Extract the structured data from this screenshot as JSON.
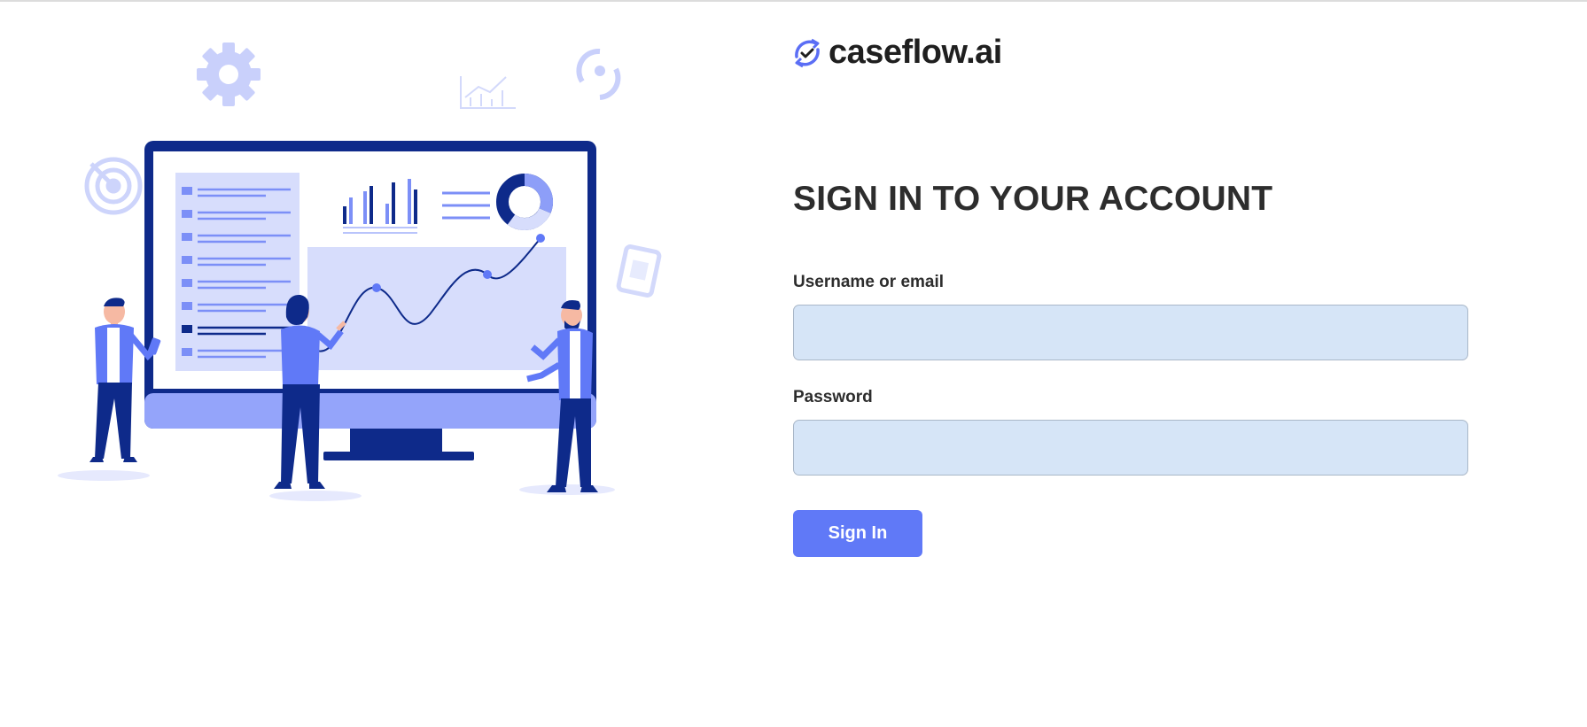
{
  "brand": {
    "name": "caseflow.ai",
    "logo_icon": "refresh-check-icon",
    "accent": "#5b6ef5"
  },
  "login": {
    "title": "SIGN IN TO YOUR ACCOUNT",
    "username_label": "Username or email",
    "username_value": "",
    "password_label": "Password",
    "password_value": "",
    "submit_label": "Sign In"
  },
  "colors": {
    "primary_button": "#6079f7",
    "input_background": "#d6e5f7",
    "heading_text": "#2d2d2d",
    "illustration_navy": "#0e2a8a",
    "illustration_periwinkle": "#8d9ef8"
  }
}
